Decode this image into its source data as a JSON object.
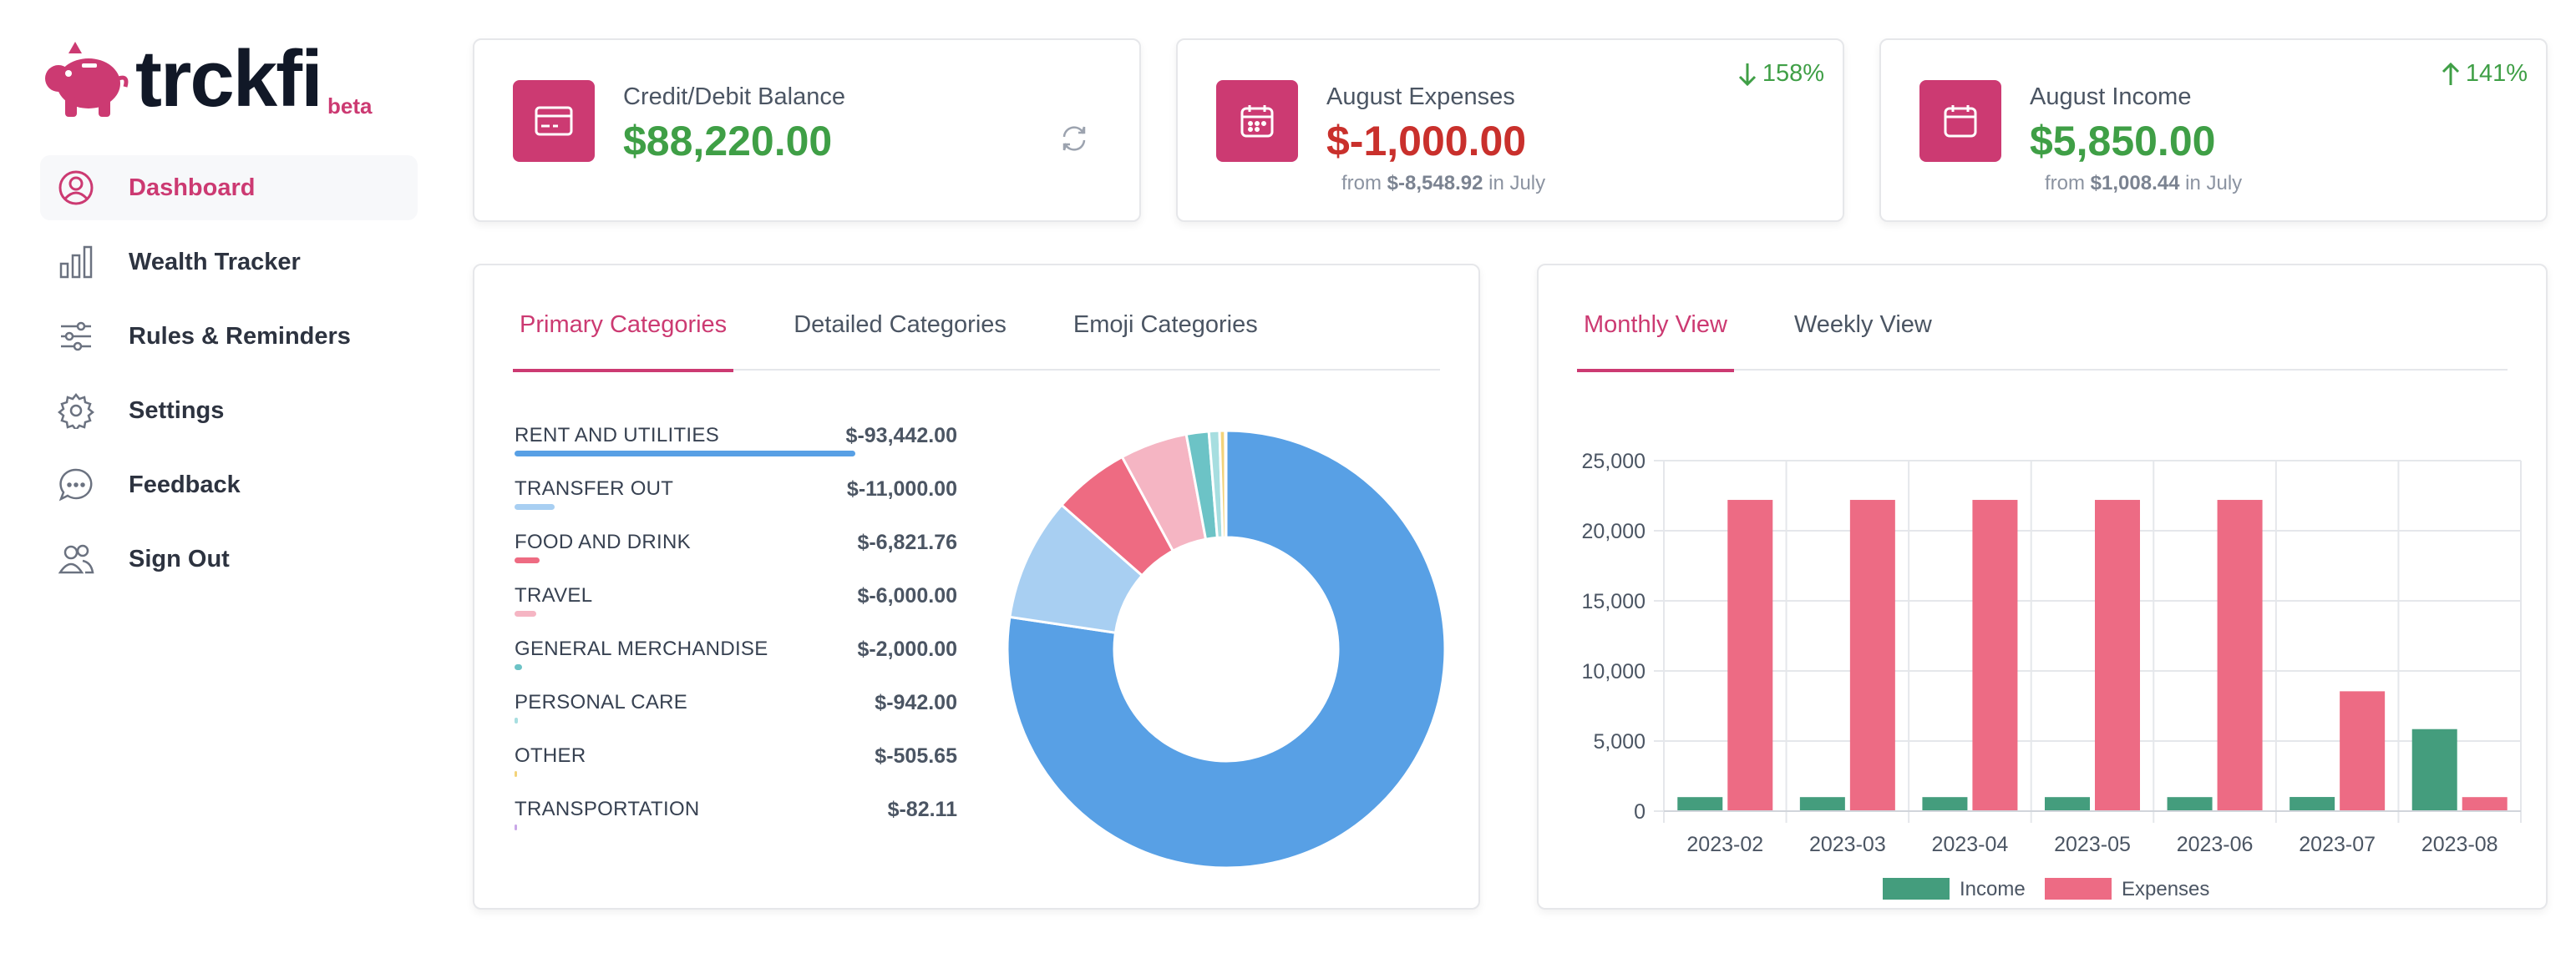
{
  "brand": {
    "name": "trckfi",
    "badge": "beta",
    "accent": "#cc3a72"
  },
  "nav": [
    {
      "label": "Dashboard",
      "icon": "user-circle-icon",
      "active": true
    },
    {
      "label": "Wealth Tracker",
      "icon": "bar-chart-icon",
      "active": false
    },
    {
      "label": "Rules & Reminders",
      "icon": "sliders-icon",
      "active": false
    },
    {
      "label": "Settings",
      "icon": "gear-icon",
      "active": false
    },
    {
      "label": "Feedback",
      "icon": "chat-bubble-icon",
      "active": false
    },
    {
      "label": "Sign Out",
      "icon": "users-icon",
      "active": false
    }
  ],
  "stats": {
    "balance": {
      "label": "Credit/Debit Balance",
      "value": "$88,220.00",
      "icon": "credit-card-icon",
      "refresh_icon": "refresh-icon"
    },
    "expenses": {
      "label": "August Expenses",
      "value": "$-1,000.00",
      "sub_prefix": "from ",
      "sub_value": "$-8,548.92",
      "sub_suffix": " in July",
      "change": "158%",
      "change_dir": "down",
      "icon": "calendar-icon"
    },
    "income": {
      "label": "August Income",
      "value": "$5,850.00",
      "sub_prefix": "from ",
      "sub_value": "$1,008.44",
      "sub_suffix": " in July",
      "change": "141%",
      "change_dir": "up",
      "icon": "calendar-blank-icon"
    }
  },
  "categories_panel": {
    "tabs": [
      "Primary Categories",
      "Detailed Categories",
      "Emoji Categories"
    ],
    "active_tab": 0,
    "items": [
      {
        "name": "RENT AND UTILITIES",
        "amount": "$-93,442.00",
        "value": 93442.0,
        "color": "#58a0e5"
      },
      {
        "name": "TRANSFER OUT",
        "amount": "$-11,000.00",
        "value": 11000.0,
        "color": "#a8cff2"
      },
      {
        "name": "FOOD AND DRINK",
        "amount": "$-6,821.76",
        "value": 6821.76,
        "color": "#ee6b82"
      },
      {
        "name": "TRAVEL",
        "amount": "$-6,000.00",
        "value": 6000.0,
        "color": "#f5b5c3"
      },
      {
        "name": "GENERAL MERCHANDISE",
        "amount": "$-2,000.00",
        "value": 2000.0,
        "color": "#6cc3c6"
      },
      {
        "name": "PERSONAL CARE",
        "amount": "$-942.00",
        "value": 942.0,
        "color": "#a7dee0"
      },
      {
        "name": "OTHER",
        "amount": "$-505.65",
        "value": 505.65,
        "color": "#f3d37a"
      },
      {
        "name": "TRANSPORTATION",
        "amount": "$-82.11",
        "value": 82.11,
        "color": "#c9a7e8"
      }
    ]
  },
  "trend_panel": {
    "tabs": [
      "Monthly View",
      "Weekly View"
    ],
    "active_tab": 0
  },
  "chart_data": {
    "type": "bar",
    "categories": [
      "2023-02",
      "2023-03",
      "2023-04",
      "2023-05",
      "2023-06",
      "2023-07",
      "2023-08"
    ],
    "series": [
      {
        "name": "Income",
        "color": "#449d7d",
        "values": [
          1000,
          1000,
          1000,
          1000,
          1000,
          1008.44,
          5850
        ]
      },
      {
        "name": "Expenses",
        "color": "#ed6b84",
        "values": [
          22200,
          22200,
          22200,
          22200,
          22200,
          8548.92,
          1000
        ]
      }
    ],
    "ylim": [
      0,
      25000
    ],
    "yticks": [
      0,
      5000,
      10000,
      15000,
      20000,
      25000
    ],
    "ytick_labels": [
      "0",
      "5,000",
      "10,000",
      "15,000",
      "20,000",
      "25,000"
    ],
    "grid": true,
    "legend": "bottom"
  }
}
